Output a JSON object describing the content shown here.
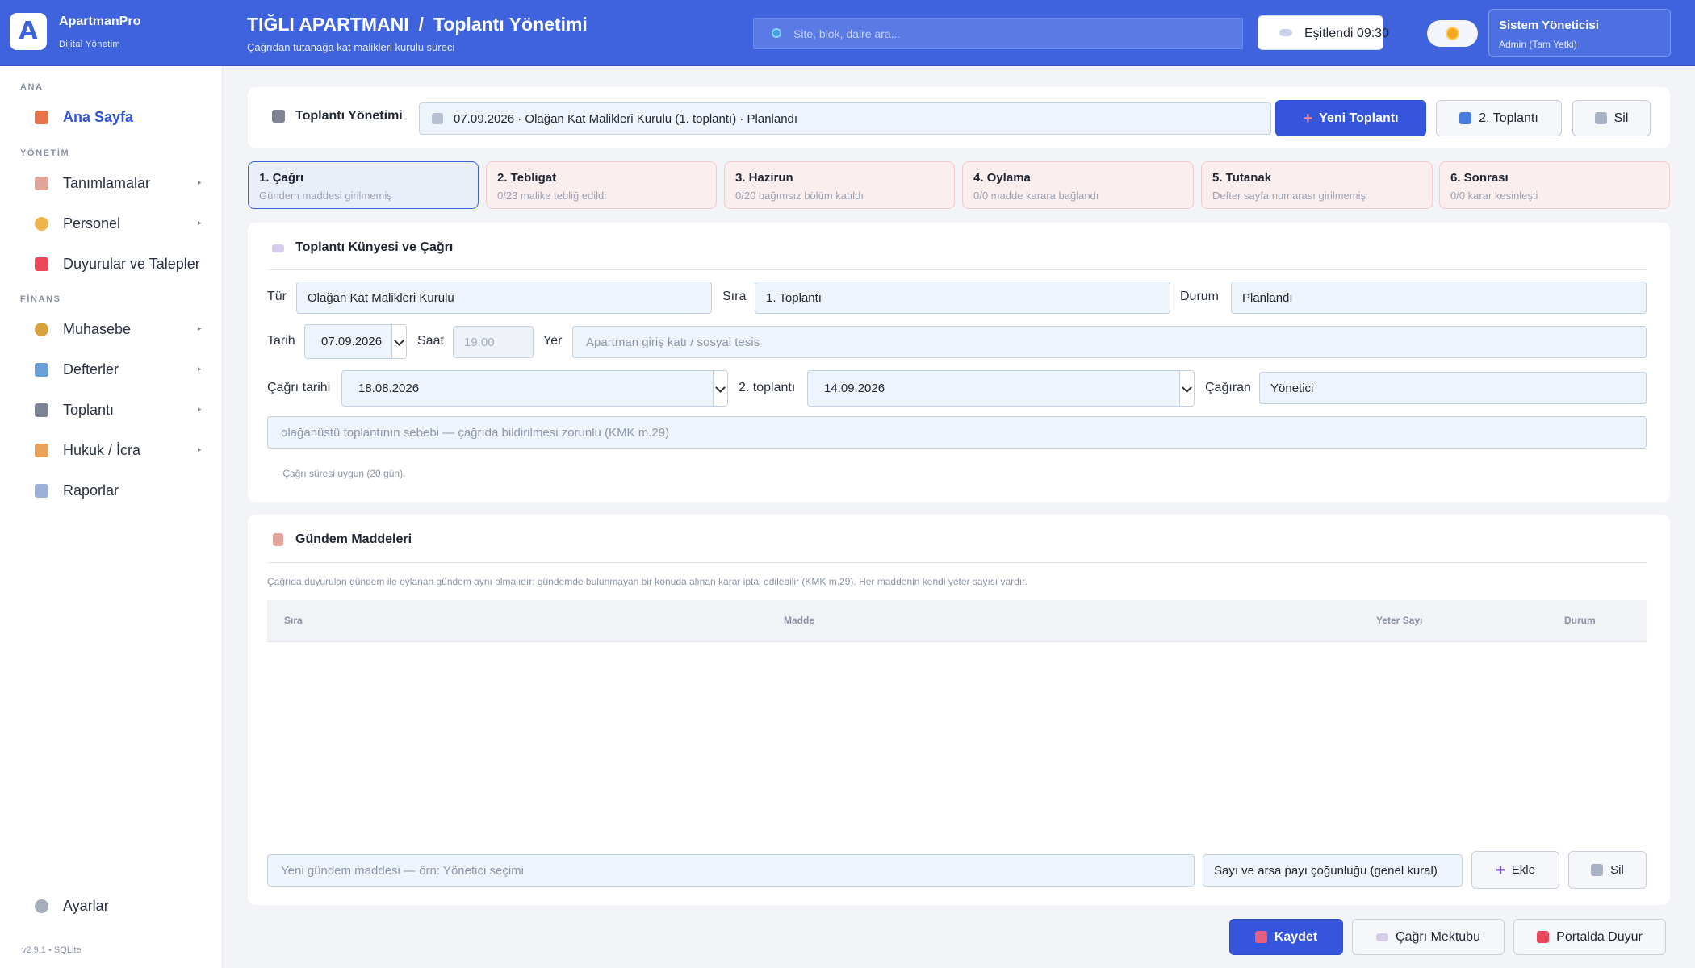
{
  "app": {
    "logo_letter": "A",
    "name": "ApartmanPro",
    "subtitle": "Dijital Yönetim"
  },
  "header": {
    "building": "TIĞLI APARTMANI",
    "separator": "/",
    "page": "Toplantı Yönetimi",
    "page_subtitle": "Çağrıdan tutanağa kat malikleri kurulu süreci",
    "search_placeholder": "Site, blok, daire ara...",
    "sync_label": "Eşitlendi 09:30",
    "user_name": "Sistem Yöneticisi",
    "user_role": "Admin (Tam Yetki)"
  },
  "sidebar": {
    "section_ana": "ANA",
    "section_yonetim": "YÖNETİM",
    "section_finans": "FİNANS",
    "items": [
      {
        "label": "Ana Sayfa",
        "icon": "home-icon",
        "active": true
      },
      {
        "label": "Tanımlamalar",
        "icon": "clipboard-icon",
        "chevron": "▸"
      },
      {
        "label": "Personel",
        "icon": "person-icon",
        "chevron": "▸"
      },
      {
        "label": "Duyurular ve Talepler",
        "icon": "megaphone-icon"
      },
      {
        "label": "Muhasebe",
        "icon": "money-bag-icon",
        "chevron": "▸"
      },
      {
        "label": "Defterler",
        "icon": "bar-chart-icon",
        "chevron": "▸"
      },
      {
        "label": "Toplantı",
        "icon": "clapper-icon",
        "chevron": "▸"
      },
      {
        "label": "Hukuk / İcra",
        "icon": "scales-icon",
        "chevron": "▸"
      },
      {
        "label": "Raporlar",
        "icon": "line-chart-icon"
      }
    ],
    "settings": "Ayarlar",
    "version": "v2.9.1 • SQLite"
  },
  "meeting_bar": {
    "title": "Toplantı Yönetimi",
    "selected_meeting": "07.09.2026 · Olağan Kat Malikleri Kurulu (1. toplantı) · Planlandı",
    "new_button": "Yeni Toplantı",
    "second_button": "2. Toplantı",
    "delete_button": "Sil"
  },
  "steps": [
    {
      "title": "1. Çağrı",
      "sub": "Gündem maddesi girilmemiş",
      "active": true
    },
    {
      "title": "2. Tebligat",
      "sub": "0/23 malike tebliğ edildi"
    },
    {
      "title": "3. Hazirun",
      "sub": "0/20 bağımsız bölüm katıldı"
    },
    {
      "title": "4. Oylama",
      "sub": "0/0 madde karara bağlandı"
    },
    {
      "title": "5. Tutanak",
      "sub": "Defter sayfa numarası girilmemiş"
    },
    {
      "title": "6. Sonrası",
      "sub": "0/0 karar kesinleşti"
    }
  ],
  "details": {
    "title": "Toplantı Künyesi ve Çağrı",
    "tur_label": "Tür",
    "tur_value": "Olağan Kat Malikleri Kurulu",
    "sira_label": "Sıra",
    "sira_value": "1. Toplantı",
    "durum_label": "Durum",
    "durum_value": "Planlandı",
    "tarih_label": "Tarih",
    "tarih_value": "07.09.2026",
    "saat_label": "Saat",
    "saat_value": "19:00",
    "yer_label": "Yer",
    "yer_placeholder": "Apartman giriş katı / sosyal tesis",
    "cagri_tarihi_label": "Çağrı tarihi",
    "cagri_tarihi_value": "18.08.2026",
    "ikinci_label": "2. toplantı",
    "ikinci_value": "14.09.2026",
    "cagiran_label": "Çağıran",
    "cagiran_value": "Yönetici",
    "sebep_placeholder": "olağanüstü toplantının sebebi — çağrıda bildirilmesi zorunlu (KMK m.29)",
    "note": "· Çağrı süresi uygun (20 gün)."
  },
  "agenda": {
    "title": "Gündem Maddeleri",
    "note": "Çağrıda duyurulan gündem ile oylanan gündem aynı olmalıdır: gündemde bulunmayan bir konuda alınan karar iptal edilebilir (KMK m.29). Her maddenin kendi yeter sayısı vardır.",
    "columns": [
      "Sıra",
      "Madde",
      "Yeter Sayı",
      "Durum"
    ],
    "new_placeholder": "Yeni gündem maddesi — örn: Yönetici seçimi",
    "quorum_value": "Sayı ve arsa payı çoğunluğu (genel kural)",
    "add_button": "Ekle",
    "delete_button": "Sil"
  },
  "footer": {
    "save": "Kaydet",
    "letter": "Çağrı Mektubu",
    "portal": "Portalda Duyur"
  },
  "colors": {
    "accent": "#3f63dc",
    "primary_button": "#3555dd",
    "step_pending": "#fbeeee"
  }
}
